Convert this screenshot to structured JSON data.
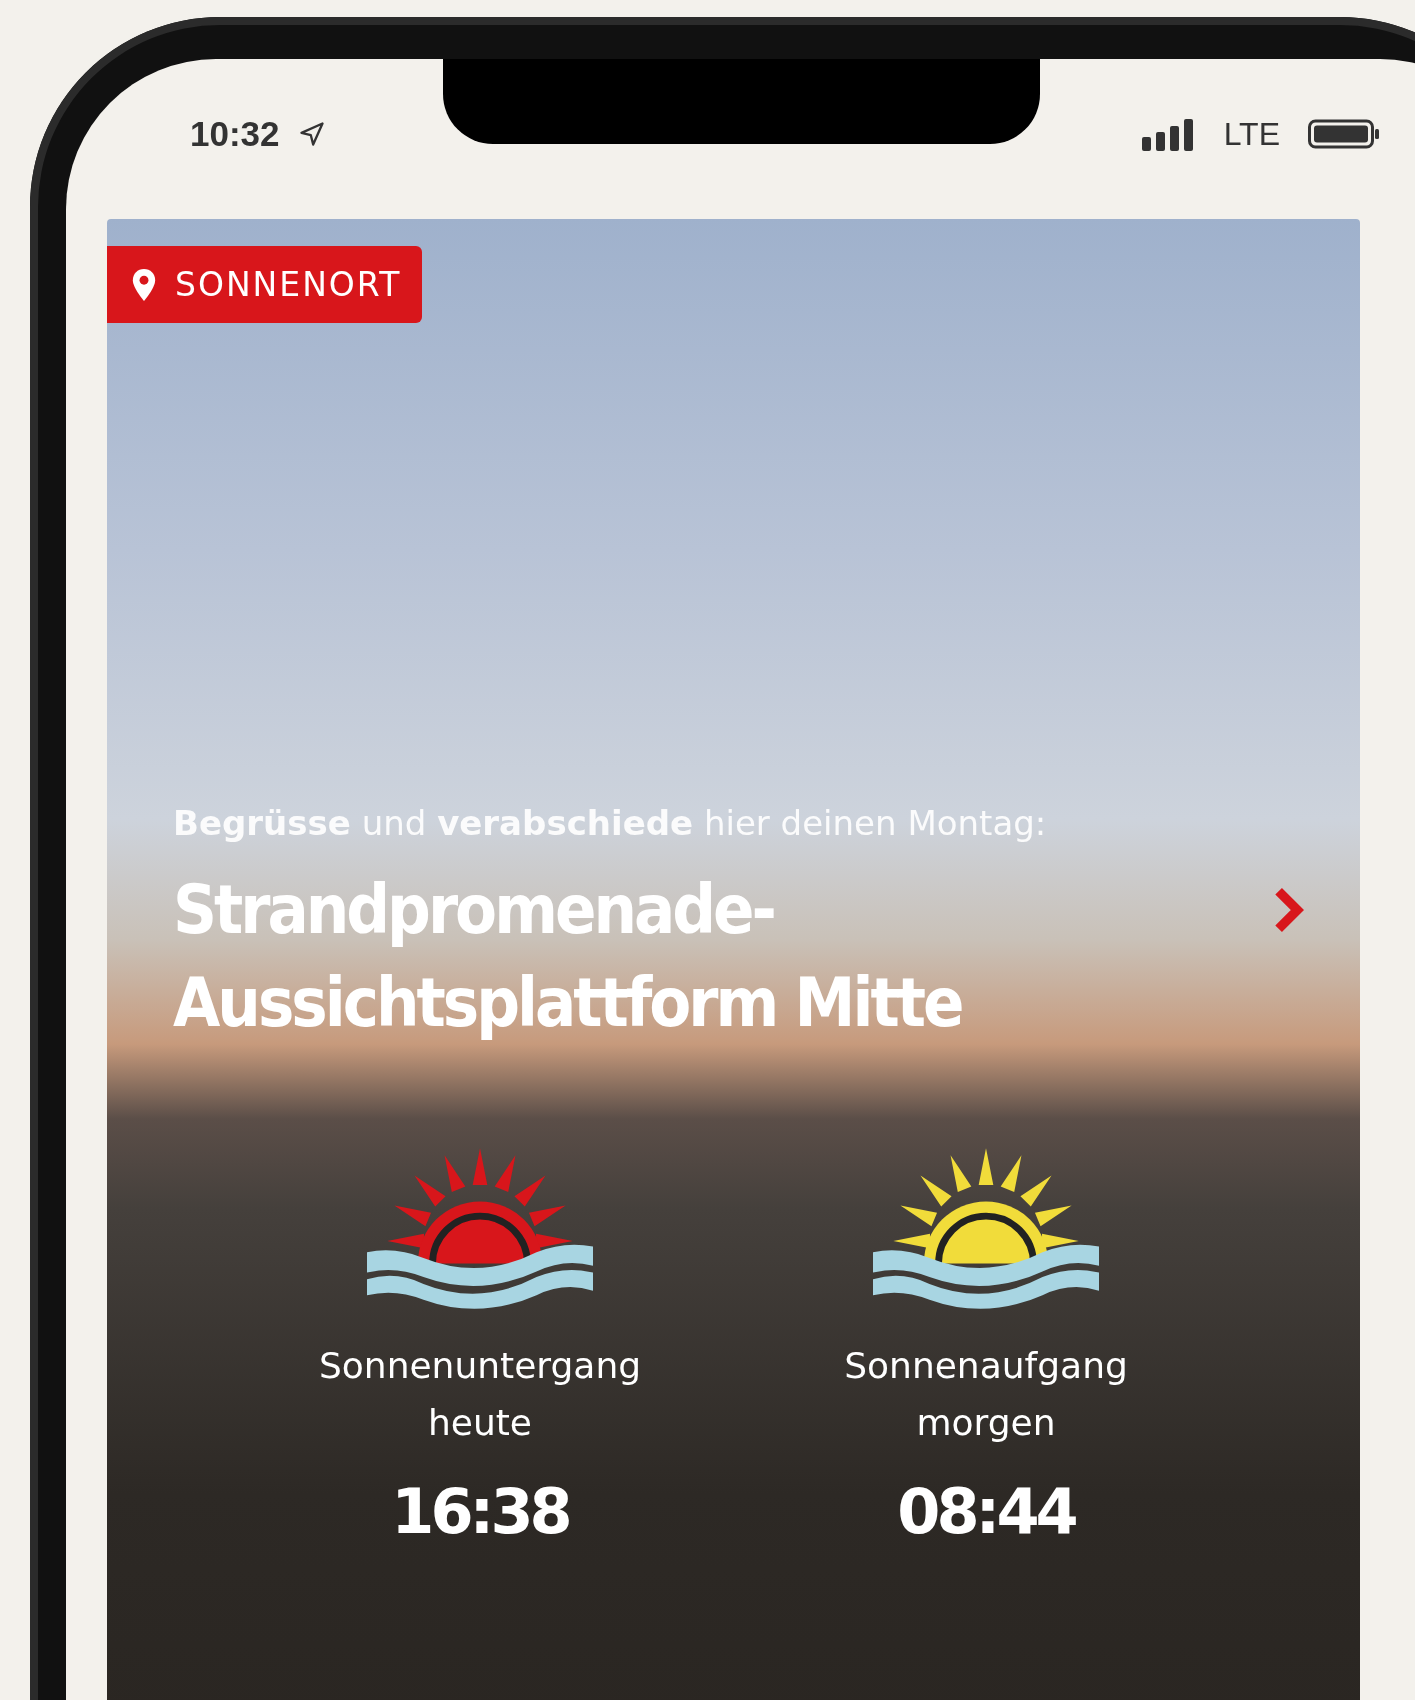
{
  "status_bar": {
    "time": "10:32",
    "network": "LTE"
  },
  "card": {
    "badge": "SONNENORT",
    "intro": "**Begrüsse** und **verabschiede** hier deinen Montag:",
    "title": "Strandpromenade-Aussichtsplattform Mitte",
    "events": [
      {
        "kind": "sunset",
        "label": "Sonnenuntergang heute",
        "time": "16:38"
      },
      {
        "kind": "sunrise",
        "label": "Sonnenaufgang morgen",
        "time": "08:44"
      }
    ]
  }
}
